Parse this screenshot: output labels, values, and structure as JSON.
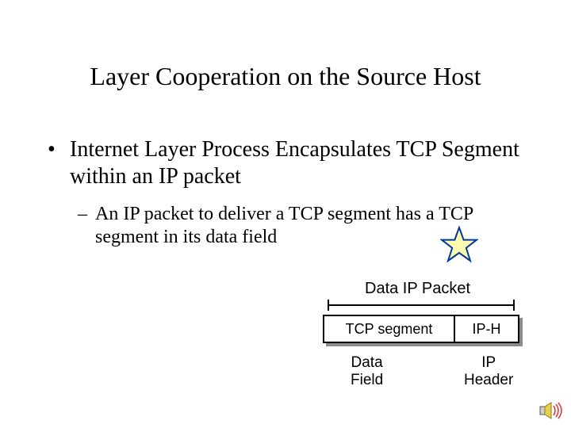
{
  "title": "Layer Cooperation on the Source Host",
  "bullets": {
    "main": "Internet Layer Process Encapsulates TCP Segment within an IP packet",
    "sub": "An IP packet to deliver a TCP segment has a TCP segment in its data field"
  },
  "diagram": {
    "title": "Data IP Packet",
    "tcp_segment": "TCP segment",
    "ip_h": "IP-H",
    "data_field_l1": "Data",
    "data_field_l2": "Field",
    "ip_header_l1": "IP",
    "ip_header_l2": "Header"
  },
  "icons": {
    "star": "star-icon",
    "sound": "sound-icon"
  },
  "colors": {
    "star_stroke": "#003a9e",
    "star_fill": "#fffbae"
  }
}
